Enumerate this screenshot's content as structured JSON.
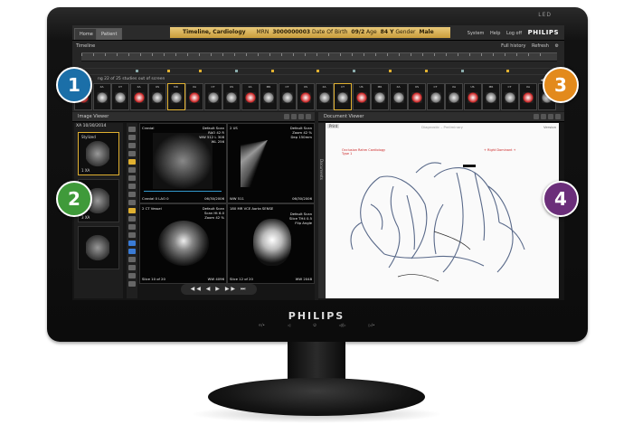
{
  "device": {
    "led_label": "LED",
    "brand": "PHILIPS",
    "front_buttons": [
      "☼/•",
      "◁",
      "⏻",
      "◁/▷",
      "▷/•"
    ]
  },
  "tabs": [
    "Home",
    "Patient"
  ],
  "patient_banner": {
    "title": "Timeline, Cardiology",
    "mrn_label": "MRN",
    "mrn": "3000000003",
    "dob_label": "Date Of Birth",
    "dob": "09/2",
    "age_label": "Age",
    "age": "84 Y",
    "gender_label": "Gender",
    "gender": "Male"
  },
  "system_menu": [
    "System",
    "Help",
    "Log off"
  ],
  "timeline": {
    "label": "Timeline",
    "history": "Full history",
    "refresh": "Refresh",
    "info": "ng 22 of 25 studies out of screen",
    "thumb_labels": [
      "US",
      "XA",
      "CT",
      "XA",
      "US",
      "MR",
      "XA",
      "CT",
      "US",
      "XA",
      "MR",
      "CT",
      "US",
      "XA",
      "CT",
      "US",
      "MR",
      "XA",
      "US",
      "CT",
      "XA",
      "US",
      "MR",
      "CT",
      "XA",
      "US"
    ]
  },
  "image_viewer": {
    "title": "Image Viewer",
    "series_header": "XA 10/30/2014",
    "series": [
      {
        "label": "Stylized",
        "caption": "1 XA"
      },
      {
        "label": "",
        "caption": "3 XA"
      },
      {
        "label": "",
        "caption": ""
      }
    ],
    "viewports": [
      {
        "top_left": "Cranial",
        "top_right": "Default Scan\nRAO 42 R\nWW 512 L 308\nWL 256",
        "bottom_left": "Cranial 0 LAO 0",
        "bottom_right": "06/30/2006"
      },
      {
        "top_left": "2 US",
        "top_right": "Default Scan\nZoom 42 %\nDep 150mm",
        "bottom_left": "WW 511",
        "bottom_right": "06/30/2006"
      },
      {
        "top_left": "2 CT Vessel",
        "top_right": "Default Scan\nScan Ht 6.0\nZoom 42 %",
        "bottom_left": "Slice 10 of 20",
        "bottom_right": "WW 4096"
      },
      {
        "top_left": "180 MR VCE Aorta SENSE",
        "top_right": "Default Scan\nSlice TH4 0.5\nFlip Angle",
        "bottom_left": "Slice 12 of 20",
        "bottom_right": "WW 2048"
      }
    ],
    "playback": "◀◀ ◀ ▶ ▶▶ ⏭"
  },
  "document_viewer": {
    "title": "Document Viewer",
    "tab": "Print",
    "header": "Diagnostic – Preliminary",
    "tag": "Version",
    "side_label": "Documents",
    "annotations": [
      "Occlusion Rahm Cardiology\nType 1",
      "+ Right Dominant +"
    ]
  },
  "callouts": [
    {
      "number": "1",
      "color": "#1b6fa8"
    },
    {
      "number": "2",
      "color": "#3f9a3a"
    },
    {
      "number": "3",
      "color": "#e38a1c"
    },
    {
      "number": "4",
      "color": "#6b2e7a"
    }
  ]
}
